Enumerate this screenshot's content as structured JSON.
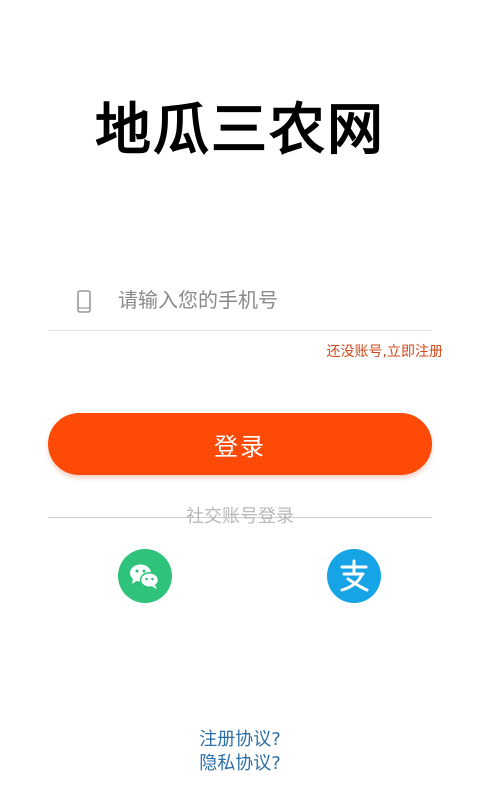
{
  "header": {
    "app_title": "地瓜三农网"
  },
  "login_form": {
    "phone_placeholder": "请输入您的手机号",
    "phone_value": "",
    "register_link": "还没账号,立即注册",
    "login_button": "登录"
  },
  "social": {
    "title": "社交账号登录",
    "providers": [
      {
        "name": "wechat",
        "icon": "wechat-icon",
        "color": "#2ec27a"
      },
      {
        "name": "alipay",
        "icon": "alipay-icon",
        "color": "#16a4e6"
      }
    ]
  },
  "footer": {
    "register_agreement": "注册协议?",
    "privacy_agreement": "隐私协议?"
  },
  "colors": {
    "accent": "#fd4a07",
    "link_orange": "#d0491a",
    "link_blue": "#2d6fa8"
  }
}
